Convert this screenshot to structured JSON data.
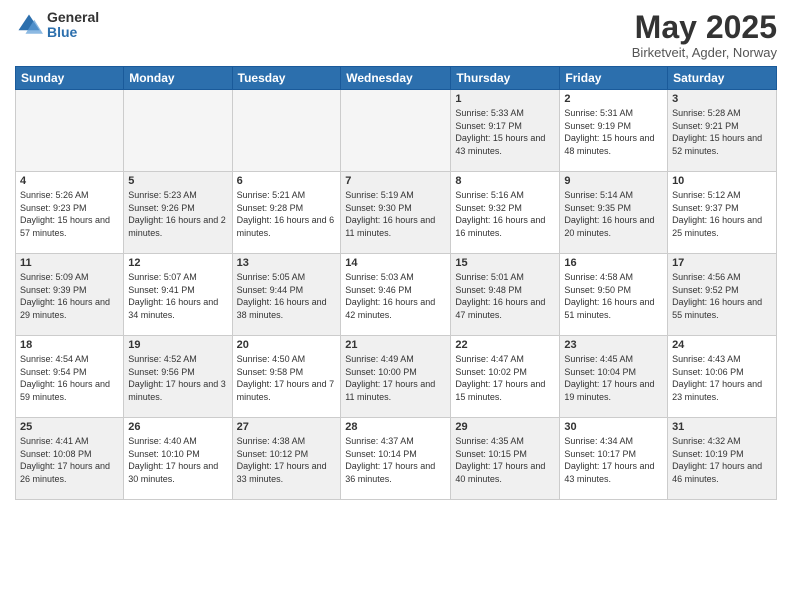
{
  "logo": {
    "general": "General",
    "blue": "Blue"
  },
  "header": {
    "month": "May 2025",
    "location": "Birketveit, Agder, Norway"
  },
  "weekdays": [
    "Sunday",
    "Monday",
    "Tuesday",
    "Wednesday",
    "Thursday",
    "Friday",
    "Saturday"
  ],
  "weeks": [
    [
      {
        "num": "",
        "info": "",
        "empty": true
      },
      {
        "num": "",
        "info": "",
        "empty": true
      },
      {
        "num": "",
        "info": "",
        "empty": true
      },
      {
        "num": "",
        "info": "",
        "empty": true
      },
      {
        "num": "1",
        "info": "Sunrise: 5:33 AM\nSunset: 9:17 PM\nDaylight: 15 hours\nand 43 minutes."
      },
      {
        "num": "2",
        "info": "Sunrise: 5:31 AM\nSunset: 9:19 PM\nDaylight: 15 hours\nand 48 minutes."
      },
      {
        "num": "3",
        "info": "Sunrise: 5:28 AM\nSunset: 9:21 PM\nDaylight: 15 hours\nand 52 minutes."
      }
    ],
    [
      {
        "num": "4",
        "info": "Sunrise: 5:26 AM\nSunset: 9:23 PM\nDaylight: 15 hours\nand 57 minutes."
      },
      {
        "num": "5",
        "info": "Sunrise: 5:23 AM\nSunset: 9:26 PM\nDaylight: 16 hours\nand 2 minutes."
      },
      {
        "num": "6",
        "info": "Sunrise: 5:21 AM\nSunset: 9:28 PM\nDaylight: 16 hours\nand 6 minutes."
      },
      {
        "num": "7",
        "info": "Sunrise: 5:19 AM\nSunset: 9:30 PM\nDaylight: 16 hours\nand 11 minutes."
      },
      {
        "num": "8",
        "info": "Sunrise: 5:16 AM\nSunset: 9:32 PM\nDaylight: 16 hours\nand 16 minutes."
      },
      {
        "num": "9",
        "info": "Sunrise: 5:14 AM\nSunset: 9:35 PM\nDaylight: 16 hours\nand 20 minutes."
      },
      {
        "num": "10",
        "info": "Sunrise: 5:12 AM\nSunset: 9:37 PM\nDaylight: 16 hours\nand 25 minutes."
      }
    ],
    [
      {
        "num": "11",
        "info": "Sunrise: 5:09 AM\nSunset: 9:39 PM\nDaylight: 16 hours\nand 29 minutes."
      },
      {
        "num": "12",
        "info": "Sunrise: 5:07 AM\nSunset: 9:41 PM\nDaylight: 16 hours\nand 34 minutes."
      },
      {
        "num": "13",
        "info": "Sunrise: 5:05 AM\nSunset: 9:44 PM\nDaylight: 16 hours\nand 38 minutes."
      },
      {
        "num": "14",
        "info": "Sunrise: 5:03 AM\nSunset: 9:46 PM\nDaylight: 16 hours\nand 42 minutes."
      },
      {
        "num": "15",
        "info": "Sunrise: 5:01 AM\nSunset: 9:48 PM\nDaylight: 16 hours\nand 47 minutes."
      },
      {
        "num": "16",
        "info": "Sunrise: 4:58 AM\nSunset: 9:50 PM\nDaylight: 16 hours\nand 51 minutes."
      },
      {
        "num": "17",
        "info": "Sunrise: 4:56 AM\nSunset: 9:52 PM\nDaylight: 16 hours\nand 55 minutes."
      }
    ],
    [
      {
        "num": "18",
        "info": "Sunrise: 4:54 AM\nSunset: 9:54 PM\nDaylight: 16 hours\nand 59 minutes."
      },
      {
        "num": "19",
        "info": "Sunrise: 4:52 AM\nSunset: 9:56 PM\nDaylight: 17 hours\nand 3 minutes."
      },
      {
        "num": "20",
        "info": "Sunrise: 4:50 AM\nSunset: 9:58 PM\nDaylight: 17 hours\nand 7 minutes."
      },
      {
        "num": "21",
        "info": "Sunrise: 4:49 AM\nSunset: 10:00 PM\nDaylight: 17 hours\nand 11 minutes."
      },
      {
        "num": "22",
        "info": "Sunrise: 4:47 AM\nSunset: 10:02 PM\nDaylight: 17 hours\nand 15 minutes."
      },
      {
        "num": "23",
        "info": "Sunrise: 4:45 AM\nSunset: 10:04 PM\nDaylight: 17 hours\nand 19 minutes."
      },
      {
        "num": "24",
        "info": "Sunrise: 4:43 AM\nSunset: 10:06 PM\nDaylight: 17 hours\nand 23 minutes."
      }
    ],
    [
      {
        "num": "25",
        "info": "Sunrise: 4:41 AM\nSunset: 10:08 PM\nDaylight: 17 hours\nand 26 minutes."
      },
      {
        "num": "26",
        "info": "Sunrise: 4:40 AM\nSunset: 10:10 PM\nDaylight: 17 hours\nand 30 minutes."
      },
      {
        "num": "27",
        "info": "Sunrise: 4:38 AM\nSunset: 10:12 PM\nDaylight: 17 hours\nand 33 minutes."
      },
      {
        "num": "28",
        "info": "Sunrise: 4:37 AM\nSunset: 10:14 PM\nDaylight: 17 hours\nand 36 minutes."
      },
      {
        "num": "29",
        "info": "Sunrise: 4:35 AM\nSunset: 10:15 PM\nDaylight: 17 hours\nand 40 minutes."
      },
      {
        "num": "30",
        "info": "Sunrise: 4:34 AM\nSunset: 10:17 PM\nDaylight: 17 hours\nand 43 minutes."
      },
      {
        "num": "31",
        "info": "Sunrise: 4:32 AM\nSunset: 10:19 PM\nDaylight: 17 hours\nand 46 minutes."
      }
    ]
  ]
}
